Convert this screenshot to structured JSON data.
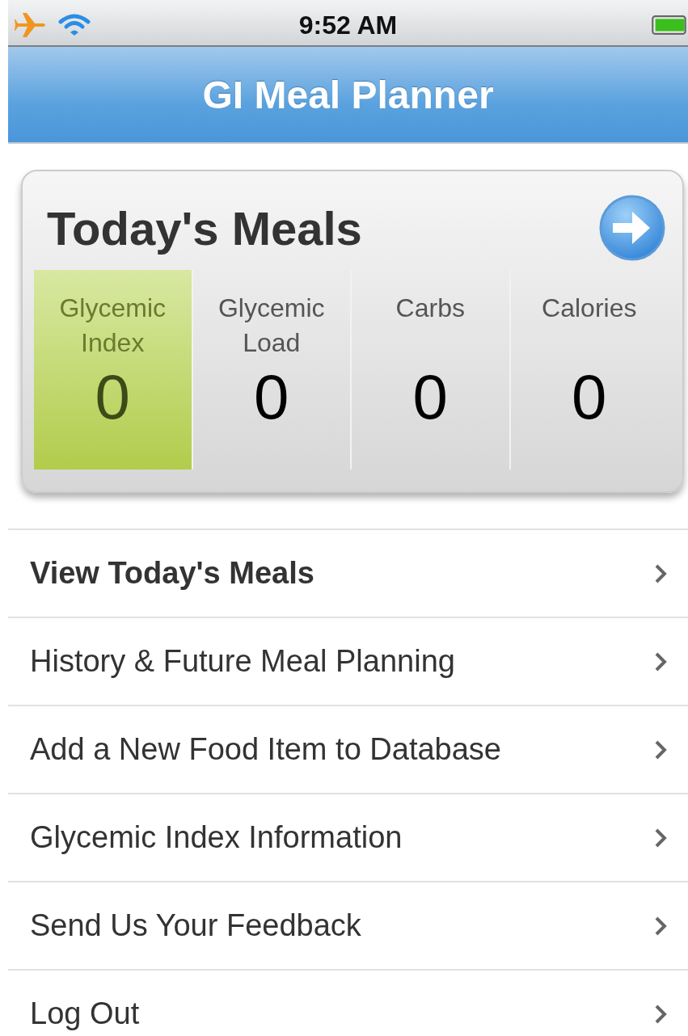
{
  "status_bar": {
    "time": "9:52 AM",
    "airplane_mode": true
  },
  "header": {
    "title": "GI Meal Planner"
  },
  "summary": {
    "title": "Today's Meals",
    "stats": [
      {
        "label": "Glycemic Index",
        "value": "0",
        "selected": true
      },
      {
        "label": "Glycemic Load",
        "value": "0",
        "selected": false
      },
      {
        "label": "Carbs",
        "value": "0",
        "selected": false
      },
      {
        "label": "Calories",
        "value": "0",
        "selected": false
      }
    ]
  },
  "menu": [
    {
      "label": "View Today's Meals",
      "bold": true
    },
    {
      "label": "History & Future Meal Planning",
      "bold": false
    },
    {
      "label": "Add a New Food Item to Database",
      "bold": false
    },
    {
      "label": "Glycemic Index Information",
      "bold": false
    },
    {
      "label": "Send Us Your Feedback",
      "bold": false
    },
    {
      "label": "Log Out",
      "bold": false
    }
  ]
}
